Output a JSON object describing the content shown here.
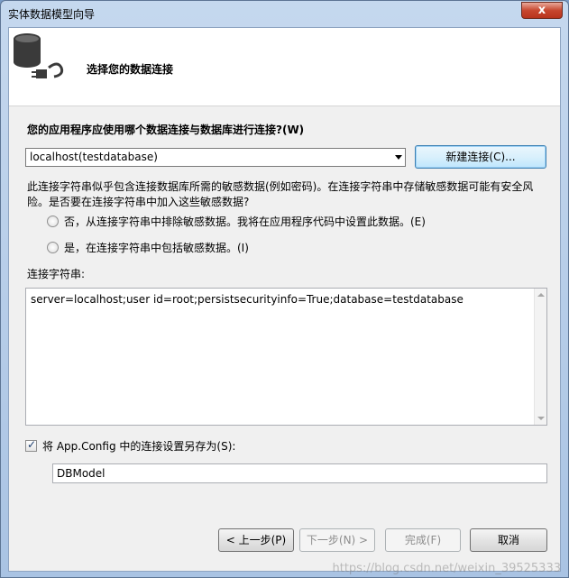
{
  "window": {
    "title": "实体数据模型向导",
    "close_symbol": "x"
  },
  "header": {
    "title": "选择您的数据连接",
    "icon": "database-plug-icon"
  },
  "connection": {
    "question": "您的应用程序应使用哪个数据连接与数据库进行连接?(W)",
    "selected": "localhost(testdatabase)",
    "new_button": "新建连接(C)..."
  },
  "sensitive": {
    "warning": "此连接字符串似乎包含连接数据库所需的敏感数据(例如密码)。在连接字符串中存储敏感数据可能有安全风险。是否要在连接字符串中加入这些敏感数据?",
    "option_exclude": "否，从连接字符串中排除敏感数据。我将在应用程序代码中设置此数据。(E)",
    "option_include": "是，在连接字符串中包括敏感数据。(I)"
  },
  "connection_string": {
    "label": "连接字符串:",
    "value": "server=localhost;user id=root;persistsecurityinfo=True;database=testdatabase"
  },
  "save": {
    "checked": true,
    "label": "将 App.Config 中的连接设置另存为(S):",
    "value": "DBModel"
  },
  "footer": {
    "back": "< 上一步(P)",
    "next": "下一步(N) >",
    "finish": "完成(F)",
    "cancel": "取消"
  },
  "watermark": "https://blog.csdn.net/weixin_39525333"
}
